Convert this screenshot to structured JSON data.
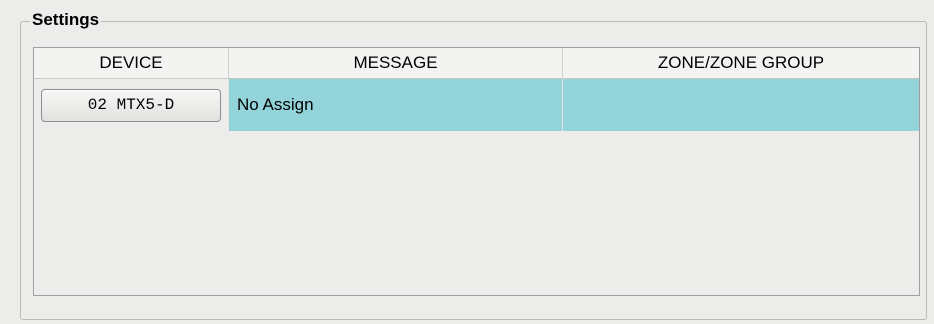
{
  "settings": {
    "title": "Settings"
  },
  "grid": {
    "columns": [
      "DEVICE",
      "MESSAGE",
      "ZONE/ZONE GROUP"
    ],
    "rows": [
      {
        "device": "02 MTX5-D",
        "message": "No Assign",
        "zone": ""
      }
    ]
  },
  "colors": {
    "selected_cell": "#93d4db",
    "panel_background": "#ececea"
  }
}
